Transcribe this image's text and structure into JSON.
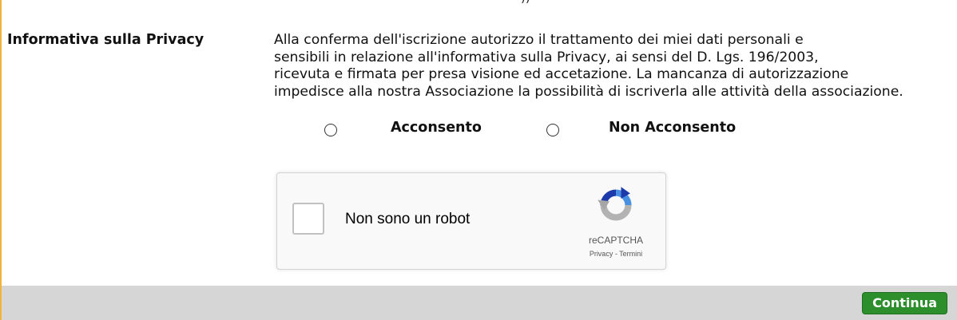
{
  "top_fragment": "))",
  "privacy": {
    "label": "Informativa sulla Privacy",
    "text_lines": [
      "Alla conferma dell'iscrizione autorizzo il trattamento dei miei dati personali e",
      "sensibili in relazione all'informativa sulla Privacy, ai sensi del D. Lgs. 196/2003,",
      "ricevuta e firmata per presa visione ed accetazione. La mancanza di autorizzazione",
      "impedisce alla nostra Associazione la possibilità di iscriverla alle attività della associazione."
    ],
    "options": [
      {
        "label": "Acconsento",
        "selected": false
      },
      {
        "label": "Non Acconsento",
        "selected": false
      }
    ]
  },
  "recaptcha": {
    "label": "Non sono un robot",
    "brand": "reCAPTCHA",
    "privacy_link": "Privacy",
    "separator": " - ",
    "terms_link": "Termini",
    "checked": false
  },
  "footer": {
    "continue_label": "Continua",
    "button_color": "#2c8f2c"
  },
  "colors": {
    "accent_border": "#f0b33c",
    "footer_bar": "#d6d6d6"
  }
}
